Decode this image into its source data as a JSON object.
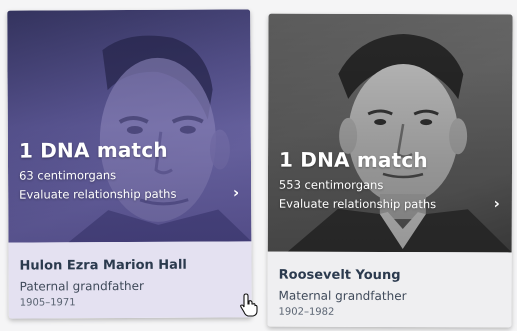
{
  "cards": [
    {
      "match_label": "1 DNA match",
      "centimorgans": "63 centimorgans",
      "evaluate_label": "Evaluate relationship paths",
      "chevron": "›",
      "name": "Hulon Ezra Marion Hall",
      "relation": "Paternal grandfather",
      "years": "1905–1971",
      "photo_tint": "#5a5690",
      "info_bg": "#e4e1f1"
    },
    {
      "match_label": "1 DNA match",
      "centimorgans": "553 centimorgans",
      "evaluate_label": "Evaluate relationship paths",
      "chevron": "›",
      "name": "Roosevelt Young",
      "relation": "Maternal grandfather",
      "years": "1902–1982",
      "photo_tint": "#6a6a6a",
      "info_bg": "#efeff1"
    }
  ],
  "icons": {
    "cursor": "hand-pointer-icon",
    "chevron": "chevron-right-icon"
  }
}
